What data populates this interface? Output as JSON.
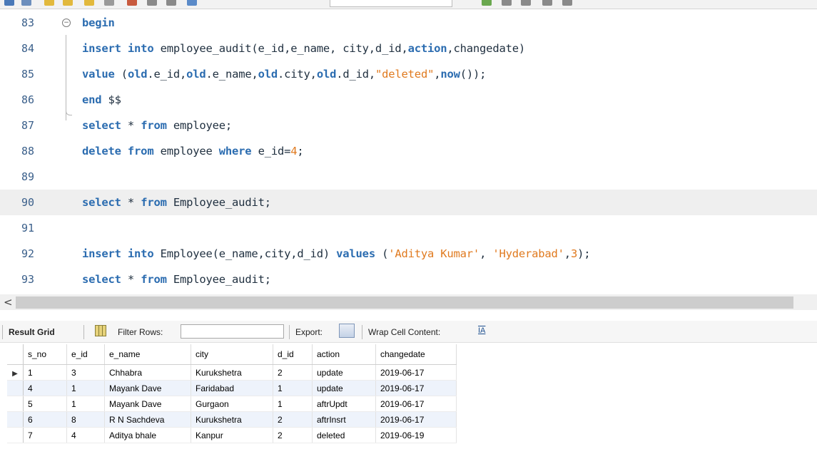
{
  "editor": {
    "lines": [
      {
        "num": "83",
        "segments": [
          {
            "t": "begin",
            "c": "kw"
          }
        ]
      },
      {
        "num": "84",
        "segments": [
          {
            "t": "insert into",
            "c": "kw"
          },
          {
            "t": " employee_audit(e_id,e_name, city,d_id,",
            "c": ""
          },
          {
            "t": "action",
            "c": "kw"
          },
          {
            "t": ",changedate)",
            "c": ""
          }
        ]
      },
      {
        "num": "85",
        "segments": [
          {
            "t": "value",
            "c": "kw"
          },
          {
            "t": " (",
            "c": ""
          },
          {
            "t": "old",
            "c": "kw"
          },
          {
            "t": ".e_id,",
            "c": ""
          },
          {
            "t": "old",
            "c": "kw"
          },
          {
            "t": ".e_name,",
            "c": ""
          },
          {
            "t": "old",
            "c": "kw"
          },
          {
            "t": ".city,",
            "c": ""
          },
          {
            "t": "old",
            "c": "kw"
          },
          {
            "t": ".d_id,",
            "c": ""
          },
          {
            "t": "\"deleted\"",
            "c": "str"
          },
          {
            "t": ",",
            "c": ""
          },
          {
            "t": "now",
            "c": "kw"
          },
          {
            "t": "());",
            "c": ""
          }
        ]
      },
      {
        "num": "86",
        "segments": [
          {
            "t": "end",
            "c": "kw"
          },
          {
            "t": " $$",
            "c": ""
          }
        ]
      },
      {
        "num": "87",
        "segments": [
          {
            "t": "select",
            "c": "kw"
          },
          {
            "t": " * ",
            "c": ""
          },
          {
            "t": "from",
            "c": "kw"
          },
          {
            "t": " employee;",
            "c": ""
          }
        ]
      },
      {
        "num": "88",
        "segments": [
          {
            "t": "delete from",
            "c": "kw"
          },
          {
            "t": " employee ",
            "c": ""
          },
          {
            "t": "where",
            "c": "kw"
          },
          {
            "t": " e_id=",
            "c": ""
          },
          {
            "t": "4",
            "c": "num"
          },
          {
            "t": ";",
            "c": ""
          }
        ]
      },
      {
        "num": "89",
        "segments": []
      },
      {
        "num": "90",
        "segments": [
          {
            "t": "select",
            "c": "kw"
          },
          {
            "t": " * ",
            "c": ""
          },
          {
            "t": "from",
            "c": "kw"
          },
          {
            "t": " Employee_audit;",
            "c": ""
          }
        ],
        "highlight": true
      },
      {
        "num": "91",
        "segments": []
      },
      {
        "num": "92",
        "segments": [
          {
            "t": "insert into",
            "c": "kw"
          },
          {
            "t": " Employee(e_name,city,d_id) ",
            "c": ""
          },
          {
            "t": "values",
            "c": "kw"
          },
          {
            "t": " (",
            "c": ""
          },
          {
            "t": "'Aditya Kumar'",
            "c": "str"
          },
          {
            "t": ", ",
            "c": ""
          },
          {
            "t": "'Hyderabad'",
            "c": "str"
          },
          {
            "t": ",",
            "c": ""
          },
          {
            "t": "3",
            "c": "num"
          },
          {
            "t": ");",
            "c": ""
          }
        ]
      },
      {
        "num": "93",
        "segments": [
          {
            "t": "select",
            "c": "kw"
          },
          {
            "t": " * ",
            "c": ""
          },
          {
            "t": "from",
            "c": "kw"
          },
          {
            "t": " Employee_audit;",
            "c": ""
          }
        ]
      }
    ]
  },
  "scroll": {
    "left_arrow": "<"
  },
  "result_toolbar": {
    "result_grid_label": "Result Grid",
    "filter_rows_label": "Filter Rows:",
    "filter_value": "",
    "export_label": "Export:",
    "wrap_label": "Wrap Cell Content:",
    "wrap_icon": "IA"
  },
  "table": {
    "columns": [
      "s_no",
      "e_id",
      "e_name",
      "city",
      "d_id",
      "action",
      "changedate"
    ],
    "rows": [
      [
        "1",
        "3",
        "Chhabra",
        "Kurukshetra",
        "2",
        "update",
        "2019-06-17"
      ],
      [
        "4",
        "1",
        "Mayank Dave",
        "Faridabad",
        "1",
        "update",
        "2019-06-17"
      ],
      [
        "5",
        "1",
        "Mayank Dave",
        "Gurgaon",
        "1",
        "aftrUpdt",
        "2019-06-17"
      ],
      [
        "6",
        "8",
        "R N Sachdeva",
        "Kurukshetra",
        "2",
        "aftrInsrt",
        "2019-06-17"
      ],
      [
        "7",
        "4",
        "Aditya bhale",
        "Kanpur",
        "2",
        "deleted",
        "2019-06-19"
      ]
    ],
    "current_row_marker": "▶"
  }
}
